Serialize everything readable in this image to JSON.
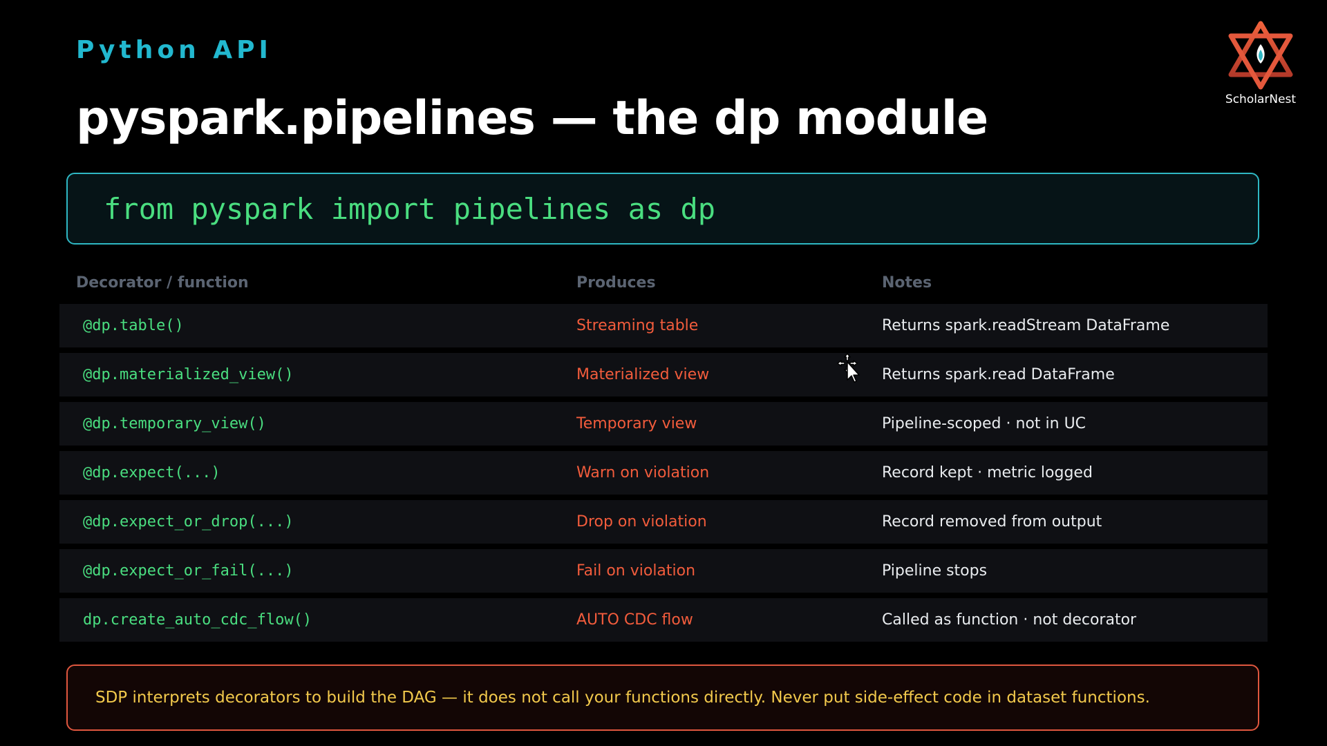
{
  "slide": {
    "eyebrow": "Python API",
    "title": "pyspark.pipelines — the dp module",
    "code": "from pyspark import pipelines as dp",
    "note": "SDP interprets decorators to build the DAG — it does not call your functions directly. Never put side-effect code in dataset functions."
  },
  "logo": {
    "name": "ScholarNest"
  },
  "table": {
    "headers": [
      "Decorator / function",
      "Produces",
      "Notes"
    ],
    "rows": [
      {
        "code": "@dp.table()",
        "produces": "Streaming table",
        "notes": "Returns spark.readStream DataFrame"
      },
      {
        "code": "@dp.materialized_view()",
        "produces": "Materialized view",
        "notes": "Returns spark.read DataFrame"
      },
      {
        "code": "@dp.temporary_view()",
        "produces": "Temporary view",
        "notes": "Pipeline-scoped · not in UC"
      },
      {
        "code": "@dp.expect(...)",
        "produces": "Warn on violation",
        "notes": "Record kept · metric logged"
      },
      {
        "code": "@dp.expect_or_drop(...)",
        "produces": "Drop on violation",
        "notes": "Record removed from output"
      },
      {
        "code": "@dp.expect_or_fail(...)",
        "produces": "Fail on violation",
        "notes": "Pipeline stops"
      },
      {
        "code": "dp.create_auto_cdc_flow()",
        "produces": "AUTO CDC flow",
        "notes": "Called as function · not decorator"
      }
    ]
  },
  "colors": {
    "accent_cyan": "#22b8cf",
    "code_green": "#4ade80",
    "produces_red": "#f25c3c",
    "note_border": "#e0573f",
    "note_text": "#f2c94c"
  },
  "icons": {
    "logo_icon": "star-of-david-flame-icon",
    "cursor_icon": "move-cursor-icon"
  }
}
